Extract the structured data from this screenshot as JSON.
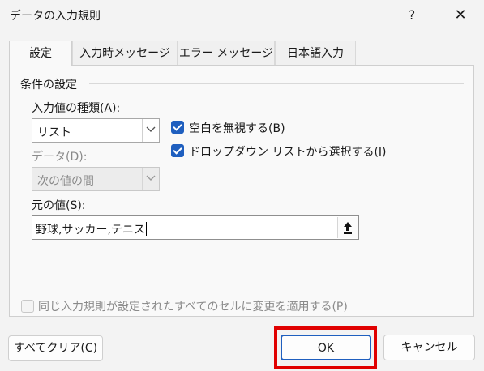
{
  "dialog": {
    "title": "データの入力規則",
    "help_glyph": "?",
    "close_glyph": "✕"
  },
  "tabs": [
    {
      "label": "設定",
      "active": true
    },
    {
      "label": "入力時メッセージ",
      "active": false
    },
    {
      "label": "エラー メッセージ",
      "active": false
    },
    {
      "label": "日本語入力",
      "active": false
    }
  ],
  "settings": {
    "group_label": "条件の設定",
    "allow_label": "入力値の種類(A):",
    "allow_value": "リスト",
    "data_label": "データ(D):",
    "data_value": "次の値の間",
    "source_label": "元の値(S):",
    "source_value": "野球,サッカー,テニス",
    "ignore_blank_label": "空白を無視する(B)",
    "ignore_blank_checked": true,
    "in_cell_dropdown_label": "ドロップダウン リストから選択する(I)",
    "in_cell_dropdown_checked": true,
    "apply_all_label": "同じ入力規則が設定されたすべてのセルに変更を適用する(P)",
    "apply_all_checked": false
  },
  "buttons": {
    "clear_all": "すべてクリア(C)",
    "ok": "OK",
    "cancel": "キャンセル"
  },
  "colors": {
    "accent": "#1f5fbf",
    "highlight": "#e00000"
  }
}
